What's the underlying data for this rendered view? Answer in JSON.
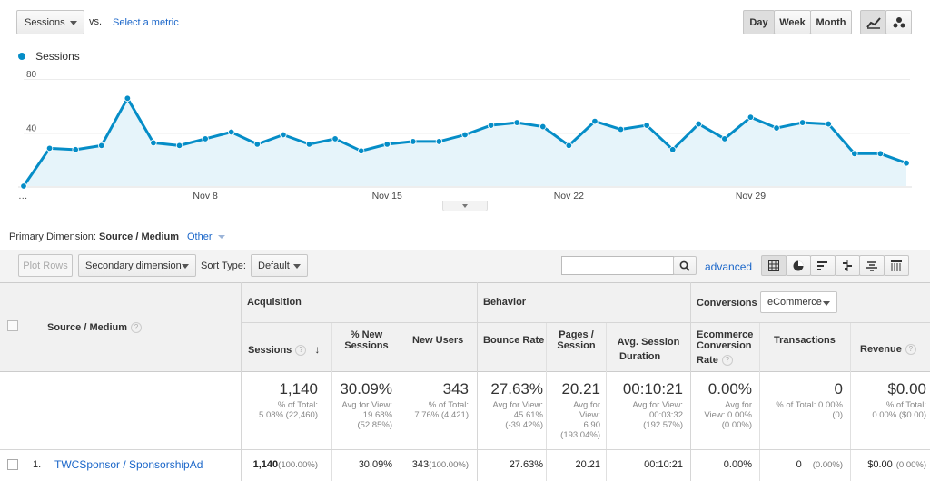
{
  "topbar": {
    "metric_select": "Sessions",
    "vs_label": "vs.",
    "select_metric_link": "Select a metric",
    "granularity": [
      "Day",
      "Week",
      "Month"
    ],
    "active_granularity": "Day"
  },
  "chart_data": {
    "type": "area",
    "legend": "Sessions",
    "color": "#058dc7",
    "y_ticks": [
      "80",
      "40"
    ],
    "ylim": [
      0,
      80
    ],
    "x_labels": [
      "…",
      "Nov 8",
      "Nov 15",
      "Nov 22",
      "Nov 29"
    ],
    "x_label_index": [
      0,
      7,
      14,
      21,
      28
    ],
    "values": [
      0,
      28,
      27,
      30,
      65,
      32,
      30,
      35,
      40,
      31,
      38,
      31,
      35,
      26,
      31,
      33,
      33,
      38,
      45,
      47,
      44,
      30,
      48,
      42,
      45,
      27,
      46,
      35,
      51,
      43,
      47,
      46,
      24,
      24,
      17
    ]
  },
  "dimension": {
    "label": "Primary Dimension:",
    "active": "Source / Medium",
    "other": "Other"
  },
  "toolbar": {
    "plot_rows": "Plot Rows",
    "secondary_dimension": "Secondary dimension",
    "sort_type_label": "Sort Type:",
    "sort_type_value": "Default",
    "search_placeholder": "",
    "advanced": "advanced"
  },
  "table": {
    "groups": {
      "acquisition": "Acquisition",
      "behavior": "Behavior",
      "conversions": "Conversions",
      "conversions_select": "eCommerce"
    },
    "headers": {
      "source_medium": "Source / Medium",
      "sessions": "Sessions",
      "new_sessions_1": "% New",
      "new_sessions_2": "Sessions",
      "new_users": "New Users",
      "bounce_rate": "Bounce Rate",
      "pages_1": "Pages /",
      "pages_2": "Session",
      "duration_1": "Avg. Session",
      "duration_2": "Duration",
      "conv_1": "Ecommerce",
      "conv_2": "Conversion",
      "conv_3": "Rate",
      "transactions": "Transactions",
      "revenue": "Revenue"
    },
    "totals": {
      "sessions": "1,140",
      "sessions_sub1": "% of Total:",
      "sessions_sub2": "5.08% (22,460)",
      "new_sessions": "30.09%",
      "new_sessions_sub1": "Avg for View:",
      "new_sessions_sub2": "19.68%",
      "new_sessions_sub3": "(52.85%)",
      "new_users": "343",
      "new_users_sub1": "% of Total:",
      "new_users_sub2": "7.76% (4,421)",
      "bounce_rate": "27.63%",
      "bounce_sub1": "Avg for View:",
      "bounce_sub2": "45.61%",
      "bounce_sub3": "(-39.42%)",
      "pages": "20.21",
      "pages_sub1": "Avg for",
      "pages_sub2": "View:",
      "pages_sub3": "6.90",
      "pages_sub4": "(193.04%)",
      "duration": "00:10:21",
      "duration_sub1": "Avg for View:",
      "duration_sub2": "00:03:32",
      "duration_sub3": "(192.57%)",
      "conv": "0.00%",
      "conv_sub1": "Avg for",
      "conv_sub2": "View: 0.00%",
      "conv_sub3": "(0.00%)",
      "transactions": "0",
      "trans_sub1": "% of Total: 0.00%",
      "trans_sub2": "(0)",
      "revenue": "$0.00",
      "rev_sub1": "% of Total:",
      "rev_sub2": "0.00% ($0.00)"
    },
    "row": {
      "index": "1.",
      "source": "TWCSponsor / SponsorshipAd",
      "sessions": "1,140",
      "sessions_pct": "(100.00%)",
      "new_sessions": "30.09%",
      "new_users": "343",
      "new_users_pct": "(100.00%)",
      "bounce_rate": "27.63%",
      "pages": "20.21",
      "duration": "00:10:21",
      "conv": "0.00%",
      "transactions": "0",
      "transactions_pct": "(0.00%)",
      "revenue": "$0.00",
      "revenue_pct": "(0.00%)"
    }
  }
}
